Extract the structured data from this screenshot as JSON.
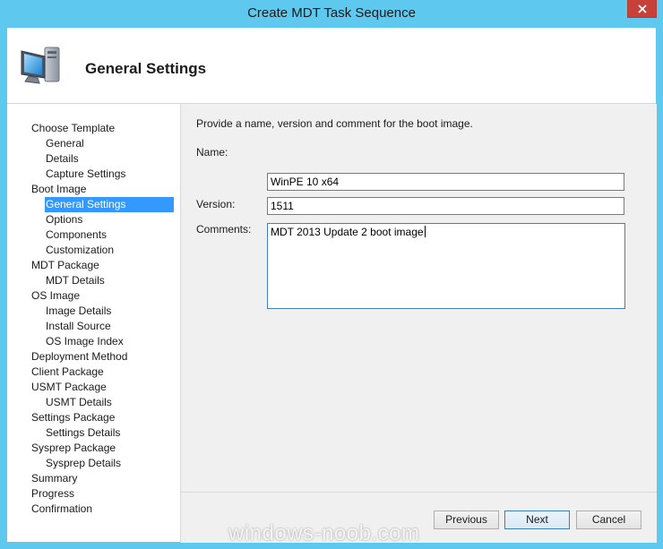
{
  "window": {
    "title": "Create MDT Task Sequence"
  },
  "header": {
    "title": "General Settings"
  },
  "nav": {
    "items": [
      {
        "label": "Choose Template",
        "level": 0
      },
      {
        "label": "General",
        "level": 1
      },
      {
        "label": "Details",
        "level": 1
      },
      {
        "label": "Capture Settings",
        "level": 1
      },
      {
        "label": "Boot Image",
        "level": 0
      },
      {
        "label": "General Settings",
        "level": 1,
        "selected": true
      },
      {
        "label": "Options",
        "level": 1
      },
      {
        "label": "Components",
        "level": 1
      },
      {
        "label": "Customization",
        "level": 1
      },
      {
        "label": "MDT Package",
        "level": 0
      },
      {
        "label": "MDT Details",
        "level": 1
      },
      {
        "label": "OS Image",
        "level": 0
      },
      {
        "label": "Image Details",
        "level": 1
      },
      {
        "label": "Install Source",
        "level": 1
      },
      {
        "label": "OS Image Index",
        "level": 1
      },
      {
        "label": "Deployment Method",
        "level": 0
      },
      {
        "label": "Client Package",
        "level": 0
      },
      {
        "label": "USMT Package",
        "level": 0
      },
      {
        "label": "USMT Details",
        "level": 1
      },
      {
        "label": "Settings Package",
        "level": 0
      },
      {
        "label": "Settings Details",
        "level": 1
      },
      {
        "label": "Sysprep Package",
        "level": 0
      },
      {
        "label": "Sysprep Details",
        "level": 1
      },
      {
        "label": "Summary",
        "level": 0
      },
      {
        "label": "Progress",
        "level": 0
      },
      {
        "label": "Confirmation",
        "level": 0
      }
    ]
  },
  "main": {
    "description": "Provide a name, version and comment for the boot image.",
    "name_label": "Name:",
    "name_value": "WinPE 10 x64",
    "version_label": "Version:",
    "version_value": "1511",
    "comments_label": "Comments:",
    "comments_value": "MDT 2013 Update 2 boot image"
  },
  "footer": {
    "previous_label": "Previous",
    "next_label": "Next",
    "cancel_label": "Cancel"
  },
  "watermark": "windows-noob.com",
  "colors": {
    "titlebar": "#5fc8ee",
    "selection": "#3399ff",
    "close": "#c7413a"
  },
  "icons": {
    "header": "computer-icon",
    "close": "close-icon"
  }
}
